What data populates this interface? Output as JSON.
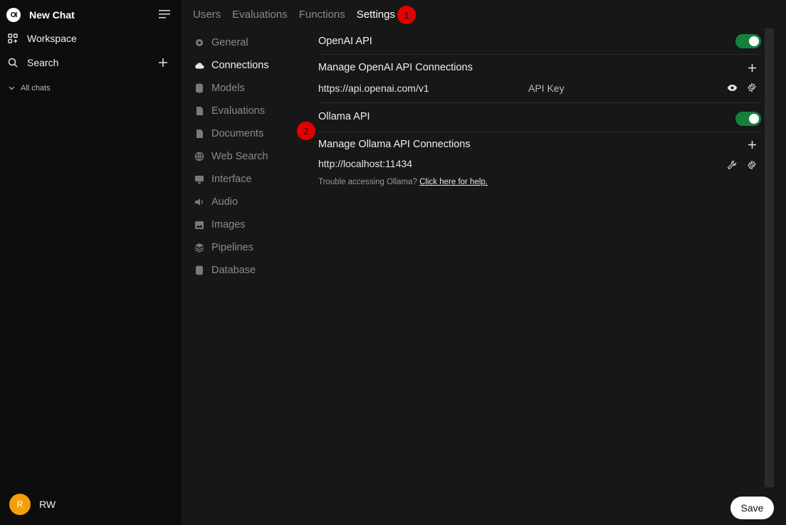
{
  "sidebar": {
    "brand_logo": "OI",
    "brand_label": "New Chat",
    "workspace_label": "Workspace",
    "search_label": "Search",
    "all_chats_label": "All chats",
    "user_initial": "R",
    "user_name": "RW"
  },
  "tabs": [
    "Users",
    "Evaluations",
    "Functions",
    "Settings"
  ],
  "markers": [
    "1",
    "2"
  ],
  "settings_nav": [
    "General",
    "Connections",
    "Models",
    "Evaluations",
    "Documents",
    "Web Search",
    "Interface",
    "Audio",
    "Images",
    "Pipelines",
    "Database"
  ],
  "openai": {
    "title": "OpenAI API",
    "manage_label": "Manage OpenAI API Connections",
    "url": "https://api.openai.com/v1",
    "api_key_label": "API Key"
  },
  "ollama": {
    "title": "Ollama API",
    "manage_label": "Manage Ollama API Connections",
    "url": "http://localhost:11434",
    "help_text": "Trouble accessing Ollama?",
    "help_link": "Click here for help."
  },
  "save_label": "Save",
  "colors": {
    "toggle_on": "#15803d",
    "marker": "#e50000",
    "avatar": "#f59e0b"
  }
}
